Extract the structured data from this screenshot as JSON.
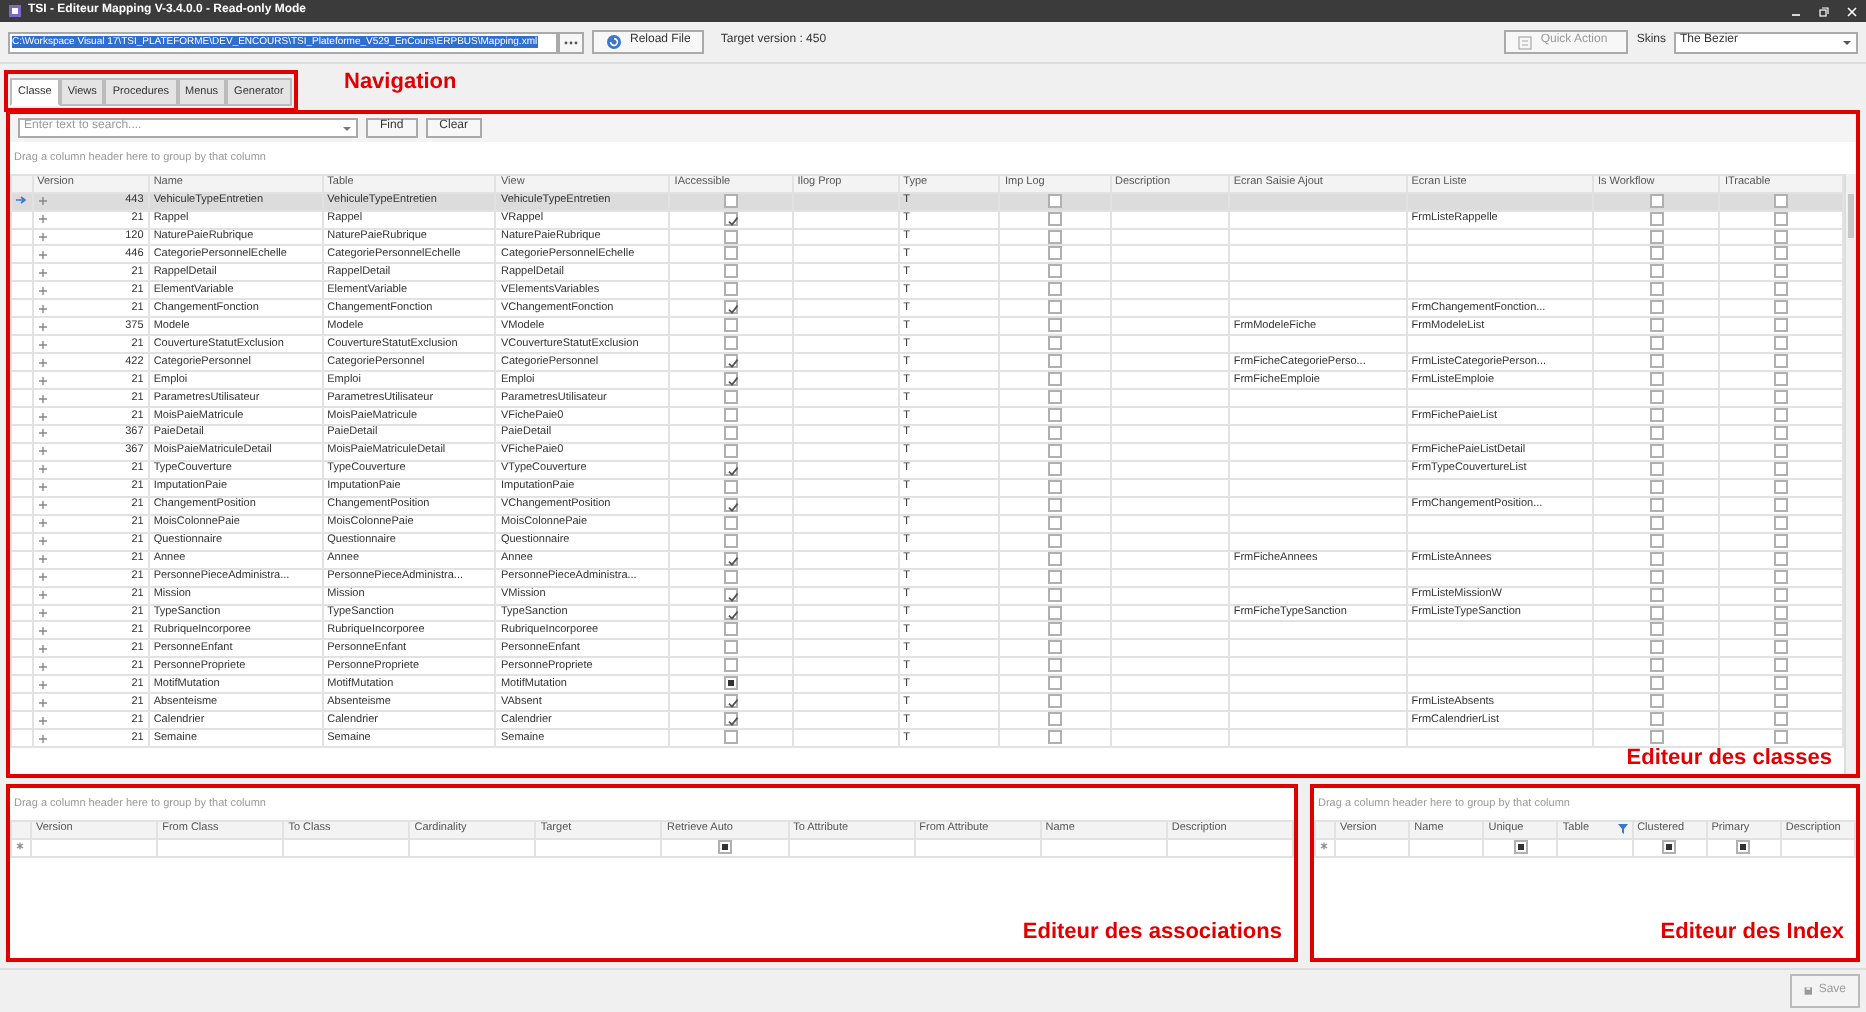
{
  "window": {
    "title": "TSI - Editeur Mapping V-3.4.0.0 - Read-only Mode"
  },
  "toolbar": {
    "file_path": "C:\\Workspace Visual 17\\TSI_PLATEFORME\\DEV_ENCOURS\\TSI_Plateforme_V529_EnCours\\ERPBUS\\Mapping.xml",
    "path_selected": true,
    "reload_button": "Reload File",
    "target_version": "Target version : 450",
    "quick_action": "Quick Action",
    "quick_action_disabled": true,
    "skins_label": "Skins",
    "skin": "The Bezier"
  },
  "tabs": [
    {
      "label": "Classe",
      "selected": true
    },
    {
      "label": "Views",
      "selected": false
    },
    {
      "label": "Procedures",
      "selected": false
    },
    {
      "label": "Menus",
      "selected": false
    },
    {
      "label": "Generator",
      "selected": false
    }
  ],
  "navigation_annotation": "Navigation",
  "classes": {
    "annotation": "Editeur des classes",
    "search_placeholder": "Enter text to search....",
    "find_button": "Find",
    "clear_button": "Clear",
    "group_hint": "Drag a column header here to group by that column",
    "columns": [
      "Version",
      "Name",
      "Table",
      "View",
      "IAccessible",
      "Ilog Prop",
      "Type",
      "Imp Log",
      "Description",
      "Ecran Saisie Ajout",
      "Ecran Liste",
      "Is Workflow",
      "ITracable"
    ],
    "rows": [
      {
        "version": "443",
        "name": "VehiculeTypeEntretien",
        "table": "VehiculeTypeEntretien",
        "view": "VehiculeTypeEntretien",
        "iaccessible": false,
        "type": "T",
        "imp_log": false,
        "is_workflow": false,
        "itracable": false,
        "selected": true
      },
      {
        "version": "21",
        "name": "Rappel",
        "table": "Rappel",
        "view": "VRappel",
        "iaccessible": true,
        "type": "T",
        "imp_log": false,
        "ecran_liste": "FrmListeRappelle",
        "is_workflow": false,
        "itracable": false,
        "selected": false
      },
      {
        "version": "120",
        "name": "NaturePaieRubrique",
        "table": "NaturePaieRubrique",
        "view": "NaturePaieRubrique",
        "iaccessible": false,
        "type": "T",
        "imp_log": false,
        "is_workflow": false,
        "itracable": false,
        "selected": false
      },
      {
        "version": "446",
        "name": "CategoriePersonnelEchelle",
        "table": "CategoriePersonnelEchelle",
        "view": "CategoriePersonnelEchelle",
        "iaccessible": false,
        "type": "T",
        "imp_log": false,
        "is_workflow": false,
        "itracable": false,
        "selected": false
      },
      {
        "version": "21",
        "name": "RappelDetail",
        "table": "RappelDetail",
        "view": "RappelDetail",
        "iaccessible": false,
        "type": "T",
        "imp_log": false,
        "is_workflow": false,
        "itracable": false,
        "selected": false
      },
      {
        "version": "21",
        "name": "ElementVariable",
        "table": "ElementVariable",
        "view": "VElementsVariables",
        "iaccessible": false,
        "type": "T",
        "imp_log": false,
        "is_workflow": false,
        "itracable": false,
        "selected": false
      },
      {
        "version": "21",
        "name": "ChangementFonction",
        "table": "ChangementFonction",
        "view": "VChangementFonction",
        "iaccessible": true,
        "type": "T",
        "imp_log": false,
        "ecran_liste": "FrmChangementFonction...",
        "is_workflow": false,
        "itracable": false,
        "selected": false
      },
      {
        "version": "375",
        "name": "Modele",
        "table": "Modele",
        "view": "VModele",
        "iaccessible": false,
        "type": "T",
        "imp_log": false,
        "ecran_saisie_ajout": "FrmModeleFiche",
        "ecran_liste": "FrmModeleList",
        "is_workflow": false,
        "itracable": false,
        "selected": false
      },
      {
        "version": "21",
        "name": "CouvertureStatutExclusion",
        "table": "CouvertureStatutExclusion",
        "view": "VCouvertureStatutExclusion",
        "iaccessible": false,
        "type": "T",
        "imp_log": false,
        "is_workflow": false,
        "itracable": false,
        "selected": false
      },
      {
        "version": "422",
        "name": "CategoriePersonnel",
        "table": "CategoriePersonnel",
        "view": "CategoriePersonnel",
        "iaccessible": true,
        "type": "T",
        "imp_log": false,
        "ecran_saisie_ajout": "FrmFicheCategoriePerso...",
        "ecran_liste": "FrmListeCategoriePerson...",
        "is_workflow": false,
        "itracable": false,
        "selected": false
      },
      {
        "version": "21",
        "name": "Emploi",
        "table": "Emploi",
        "view": "Emploi",
        "iaccessible": true,
        "type": "T",
        "imp_log": false,
        "ecran_saisie_ajout": "FrmFicheEmploie",
        "ecran_liste": "FrmListeEmploie",
        "is_workflow": false,
        "itracable": false,
        "selected": false
      },
      {
        "version": "21",
        "name": "ParametresUtilisateur",
        "table": "ParametresUtilisateur",
        "view": "ParametresUtilisateur",
        "iaccessible": false,
        "type": "T",
        "imp_log": false,
        "is_workflow": false,
        "itracable": false,
        "selected": false
      },
      {
        "version": "21",
        "name": "MoisPaieMatricule",
        "table": "MoisPaieMatricule",
        "view": "VFichePaie0",
        "iaccessible": false,
        "type": "T",
        "imp_log": false,
        "ecran_liste": "FrmFichePaieList",
        "is_workflow": false,
        "itracable": false,
        "selected": false
      },
      {
        "version": "367",
        "name": "PaieDetail",
        "table": "PaieDetail",
        "view": "PaieDetail",
        "iaccessible": false,
        "type": "T",
        "imp_log": false,
        "is_workflow": false,
        "itracable": false,
        "selected": false
      },
      {
        "version": "367",
        "name": "MoisPaieMatriculeDetail",
        "table": "MoisPaieMatriculeDetail",
        "view": "VFichePaie0",
        "iaccessible": false,
        "type": "T",
        "imp_log": false,
        "ecran_liste": "FrmFichePaieListDetail",
        "is_workflow": false,
        "itracable": false,
        "selected": false
      },
      {
        "version": "21",
        "name": "TypeCouverture",
        "table": "TypeCouverture",
        "view": "VTypeCouverture",
        "iaccessible": true,
        "type": "T",
        "imp_log": false,
        "ecran_liste": "FrmTypeCouvertureList",
        "is_workflow": false,
        "itracable": false,
        "selected": false
      },
      {
        "version": "21",
        "name": "ImputationPaie",
        "table": "ImputationPaie",
        "view": "ImputationPaie",
        "iaccessible": false,
        "type": "T",
        "imp_log": false,
        "is_workflow": false,
        "itracable": false,
        "selected": false
      },
      {
        "version": "21",
        "name": "ChangementPosition",
        "table": "ChangementPosition",
        "view": "VChangementPosition",
        "iaccessible": true,
        "type": "T",
        "imp_log": false,
        "ecran_liste": "FrmChangementPosition...",
        "is_workflow": false,
        "itracable": false,
        "selected": false
      },
      {
        "version": "21",
        "name": "MoisColonnePaie",
        "table": "MoisColonnePaie",
        "view": "MoisColonnePaie",
        "iaccessible": false,
        "type": "T",
        "imp_log": false,
        "is_workflow": false,
        "itracable": false,
        "selected": false
      },
      {
        "version": "21",
        "name": "Questionnaire",
        "table": "Questionnaire",
        "view": "Questionnaire",
        "iaccessible": false,
        "type": "T",
        "imp_log": false,
        "is_workflow": false,
        "itracable": false,
        "selected": false
      },
      {
        "version": "21",
        "name": "Annee",
        "table": "Annee",
        "view": "Annee",
        "iaccessible": true,
        "type": "T",
        "imp_log": false,
        "ecran_saisie_ajout": "FrmFicheAnnees",
        "ecran_liste": "FrmListeAnnees",
        "is_workflow": false,
        "itracable": false,
        "selected": false
      },
      {
        "version": "21",
        "name": "PersonnePieceAdministra...",
        "table": "PersonnePieceAdministra...",
        "view": "PersonnePieceAdministra...",
        "iaccessible": false,
        "type": "T",
        "imp_log": false,
        "is_workflow": false,
        "itracable": false,
        "selected": false
      },
      {
        "version": "21",
        "name": "Mission",
        "table": "Mission",
        "view": "VMission",
        "iaccessible": true,
        "type": "T",
        "imp_log": false,
        "ecran_liste": "FrmListeMissionW",
        "is_workflow": false,
        "itracable": false,
        "selected": false
      },
      {
        "version": "21",
        "name": "TypeSanction",
        "table": "TypeSanction",
        "view": "TypeSanction",
        "iaccessible": true,
        "type": "T",
        "imp_log": false,
        "ecran_saisie_ajout": "FrmFicheTypeSanction",
        "ecran_liste": "FrmListeTypeSanction",
        "is_workflow": false,
        "itracable": false,
        "selected": false
      },
      {
        "version": "21",
        "name": "RubriqueIncorporee",
        "table": "RubriqueIncorporee",
        "view": "RubriqueIncorporee",
        "iaccessible": false,
        "type": "T",
        "imp_log": false,
        "is_workflow": false,
        "itracable": false,
        "selected": false
      },
      {
        "version": "21",
        "name": "PersonneEnfant",
        "table": "PersonneEnfant",
        "view": "PersonneEnfant",
        "iaccessible": false,
        "type": "T",
        "imp_log": false,
        "is_workflow": false,
        "itracable": false,
        "selected": false
      },
      {
        "version": "21",
        "name": "PersonnePropriete",
        "table": "PersonnePropriete",
        "view": "PersonnePropriete",
        "iaccessible": false,
        "type": "T",
        "imp_log": false,
        "is_workflow": false,
        "itracable": false,
        "selected": false
      },
      {
        "version": "21",
        "name": "MotifMutation",
        "table": "MotifMutation",
        "view": "MotifMutation",
        "iaccessible_mixed": true,
        "type": "T",
        "imp_log": false,
        "is_workflow": false,
        "itracable": false,
        "selected": false
      },
      {
        "version": "21",
        "name": "Absenteisme",
        "table": "Absenteisme",
        "view": "VAbsent",
        "iaccessible": true,
        "type": "T",
        "imp_log": false,
        "ecran_liste": "FrmListeAbsents",
        "is_workflow": false,
        "itracable": false,
        "selected": false
      },
      {
        "version": "21",
        "name": "Calendrier",
        "table": "Calendrier",
        "view": "Calendrier",
        "iaccessible": true,
        "type": "T",
        "imp_log": false,
        "ecran_liste": "FrmCalendrierList",
        "is_workflow": false,
        "itracable": false,
        "selected": false
      },
      {
        "version": "21",
        "name": "Semaine",
        "table": "Semaine",
        "view": "Semaine",
        "iaccessible": false,
        "type": "T",
        "imp_log": false,
        "is_workflow": false,
        "itracable": false,
        "selected": false
      }
    ]
  },
  "associations": {
    "annotation": "Editeur des associations",
    "group_hint": "Drag a column header here to group by that column",
    "columns": [
      {
        "label": "Version"
      },
      {
        "label": "From Class"
      },
      {
        "label": "To Class"
      },
      {
        "label": "Cardinality"
      },
      {
        "label": "Target"
      },
      {
        "label": "Retrieve Auto",
        "new_row_mixed": true
      },
      {
        "label": "To Attribute"
      },
      {
        "label": "From Attribute"
      },
      {
        "label": "Name"
      },
      {
        "label": "Description"
      }
    ]
  },
  "indexes": {
    "annotation": "Editeur des Index",
    "group_hint": "Drag a column header here to group by that column",
    "columns": [
      {
        "label": "Version"
      },
      {
        "label": "Name"
      },
      {
        "label": "Unique",
        "new_row_mixed": true
      },
      {
        "label": "Table",
        "filtered": true
      },
      {
        "label": "Clustered",
        "new_row_mixed": true
      },
      {
        "label": "Primary",
        "new_row_mixed": true
      },
      {
        "label": "Description"
      }
    ]
  },
  "footer": {
    "save_button": "Save",
    "save_disabled": true
  }
}
